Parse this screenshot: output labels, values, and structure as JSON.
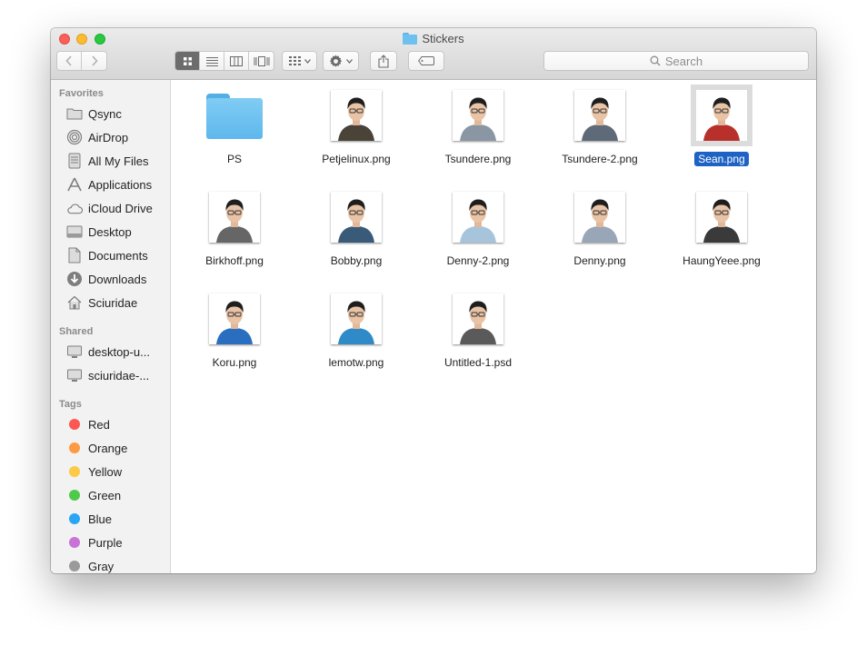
{
  "window": {
    "title": "Stickers"
  },
  "toolbar": {
    "back_icon": "chevron-left-icon",
    "forward_icon": "chevron-right-icon",
    "views": [
      "icon-view",
      "list-view",
      "column-view",
      "cover-flow-view"
    ],
    "active_view": "icon-view",
    "arrange_icon": "arrange-grid-icon",
    "action_icon": "gear-icon",
    "share_icon": "share-icon",
    "tag_icon": "tag-icon",
    "search_placeholder": "Search"
  },
  "sidebar": {
    "favorites_label": "Favorites",
    "favorites": [
      {
        "label": "Qsync",
        "icon": "folder-icon"
      },
      {
        "label": "AirDrop",
        "icon": "airdrop-icon"
      },
      {
        "label": "All My Files",
        "icon": "all-files-icon"
      },
      {
        "label": "Applications",
        "icon": "applications-icon"
      },
      {
        "label": "iCloud Drive",
        "icon": "cloud-icon"
      },
      {
        "label": "Desktop",
        "icon": "desktop-icon"
      },
      {
        "label": "Documents",
        "icon": "documents-icon"
      },
      {
        "label": "Downloads",
        "icon": "downloads-icon"
      },
      {
        "label": "Sciuridae",
        "icon": "home-icon"
      }
    ],
    "shared_label": "Shared",
    "shared": [
      {
        "label": "desktop-u...",
        "icon": "computer-icon"
      },
      {
        "label": "sciuridae-...",
        "icon": "computer-icon"
      }
    ],
    "tags_label": "Tags",
    "tags": [
      {
        "label": "Red",
        "color": "#fc5753"
      },
      {
        "label": "Orange",
        "color": "#fd9a43"
      },
      {
        "label": "Yellow",
        "color": "#fdc946"
      },
      {
        "label": "Green",
        "color": "#4fc94b"
      },
      {
        "label": "Blue",
        "color": "#2aa4f4"
      },
      {
        "label": "Purple",
        "color": "#c873d6"
      },
      {
        "label": "Gray",
        "color": "#9a9a9a"
      }
    ]
  },
  "files": [
    {
      "name": "PS",
      "kind": "folder"
    },
    {
      "name": "Petjelinux.png",
      "kind": "image",
      "shirt": "#4a4438",
      "bg": "#ffffff"
    },
    {
      "name": "Tsundere.png",
      "kind": "image",
      "shirt": "#8b96a4",
      "bg": "#ffffff"
    },
    {
      "name": "Tsundere-2.png",
      "kind": "image",
      "shirt": "#5e6a78",
      "bg": "#ffffff"
    },
    {
      "name": "Sean.png",
      "kind": "image",
      "shirt": "#b8302c",
      "bg": "#ffffff",
      "selected": true
    },
    {
      "name": "Birkhoff.png",
      "kind": "image",
      "shirt": "#666666",
      "bg": "#ffffff"
    },
    {
      "name": "Bobby.png",
      "kind": "image",
      "shirt": "#3a5a7a",
      "bg": "#ffffff"
    },
    {
      "name": "Denny-2.png",
      "kind": "image",
      "shirt": "#a6c4dc",
      "bg": "#ffffff"
    },
    {
      "name": "Denny.png",
      "kind": "image",
      "shirt": "#98a6b8",
      "bg": "#ffffff"
    },
    {
      "name": "HaungYeee.png",
      "kind": "image",
      "shirt": "#3a3a3a",
      "bg": "#ffffff"
    },
    {
      "name": "Koru.png",
      "kind": "image",
      "shirt": "#2a6ec0",
      "bg": "#ffffff"
    },
    {
      "name": "lemotw.png",
      "kind": "image",
      "shirt": "#2f8ac8",
      "bg": "#ffffff"
    },
    {
      "name": "Untitled-1.psd",
      "kind": "image",
      "shirt": "#5a5a5a",
      "bg": "#ffffff"
    }
  ]
}
